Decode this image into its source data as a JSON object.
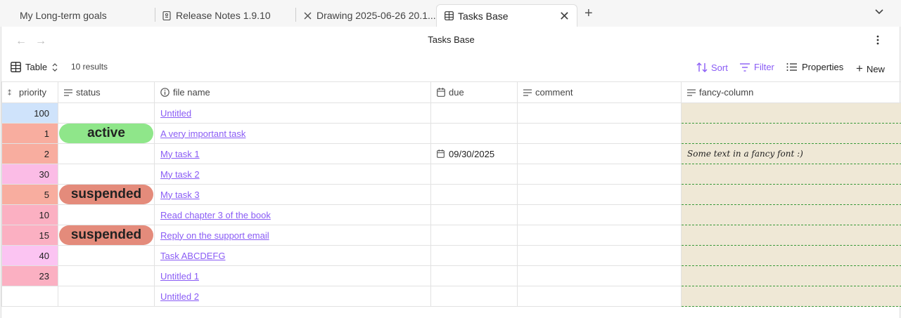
{
  "tabs": [
    {
      "label": "My Long-term goals",
      "icon": "none"
    },
    {
      "label": "Release Notes 1.9.10",
      "icon": "note-icon"
    },
    {
      "label": "Drawing 2025-06-26 20.1...",
      "icon": "drawing-icon"
    },
    {
      "label": "Tasks Base",
      "icon": "table-icon",
      "active": true
    }
  ],
  "view": {
    "title": "Tasks Base",
    "view_type": "Table",
    "results": "10 results",
    "actions": {
      "sort": "Sort",
      "filter": "Filter",
      "properties": "Properties",
      "new": "New"
    }
  },
  "columns": [
    "priority",
    "status",
    "file name",
    "due",
    "comment",
    "fancy-column"
  ],
  "rows": [
    {
      "priority": "100",
      "prio_color": "#cfe3fb",
      "status": "",
      "status_color": "",
      "file": "Untitled",
      "due": "",
      "comment": "",
      "fancy": ""
    },
    {
      "priority": "1",
      "prio_color": "#f8ad9f",
      "status": "active",
      "status_color": "#8fe68a",
      "file": "A very important task",
      "due": "",
      "comment": "",
      "fancy": ""
    },
    {
      "priority": "2",
      "prio_color": "#f8ad9f",
      "status": "",
      "status_color": "",
      "file": "My task 1",
      "due": "09/30/2025",
      "comment": "",
      "fancy": "Some text in a fancy font :)"
    },
    {
      "priority": "30",
      "prio_color": "#fbbce6",
      "status": "",
      "status_color": "",
      "file": "My task 2",
      "due": "",
      "comment": "",
      "fancy": ""
    },
    {
      "priority": "5",
      "prio_color": "#f8ad9f",
      "status": "suspended",
      "status_color": "#e48b7b",
      "file": "My task 3",
      "due": "",
      "comment": "",
      "fancy": ""
    },
    {
      "priority": "10",
      "prio_color": "#fbb0c2",
      "status": "",
      "status_color": "",
      "file": "Read chapter 3 of the book",
      "due": "",
      "comment": "",
      "fancy": ""
    },
    {
      "priority": "15",
      "prio_color": "#fbb0c2",
      "status": "suspended",
      "status_color": "#e48b7b",
      "file": "Reply on the support email",
      "due": "",
      "comment": "",
      "fancy": ""
    },
    {
      "priority": "40",
      "prio_color": "#fbc4f2",
      "status": "",
      "status_color": "",
      "file": "Task ABCDEFG",
      "due": "",
      "comment": "",
      "fancy": ""
    },
    {
      "priority": "23",
      "prio_color": "#fbb0c2",
      "status": "",
      "status_color": "",
      "file": "Untitled 1",
      "due": "",
      "comment": "",
      "fancy": ""
    },
    {
      "priority": "",
      "prio_color": "",
      "status": "",
      "status_color": "",
      "file": "Untitled 2",
      "due": "",
      "comment": "",
      "fancy": ""
    }
  ],
  "colors": {
    "accent": "#8a5cf5",
    "fancy_bg": "#efe8d6",
    "fancy_border": "#3a9a3a"
  }
}
